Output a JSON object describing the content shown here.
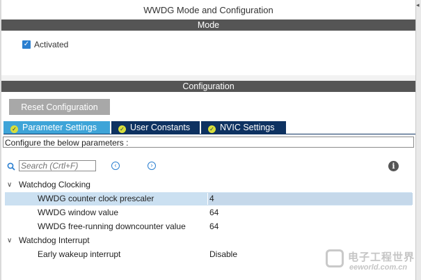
{
  "window": {
    "title": "WWDG Mode and Configuration"
  },
  "mode": {
    "header": "Mode",
    "activated": {
      "label": "Activated",
      "checked": true
    }
  },
  "configuration": {
    "header": "Configuration",
    "reset_button": "Reset Configuration",
    "tabs": [
      {
        "label": "Parameter Settings",
        "active": true
      },
      {
        "label": "User Constants",
        "active": false
      },
      {
        "label": "NVIC Settings",
        "active": false
      }
    ],
    "instructions": "Configure the below parameters :",
    "search": {
      "placeholder": "Search (Crtl+F)"
    },
    "groups": [
      {
        "label": "Watchdog Clocking",
        "params": [
          {
            "label": "WWDG counter clock prescaler",
            "value": "4",
            "selected": true
          },
          {
            "label": "WWDG window value",
            "value": "64",
            "selected": false
          },
          {
            "label": "WWDG free-running downcounter value",
            "value": "64",
            "selected": false
          }
        ]
      },
      {
        "label": "Watchdog Interrupt",
        "params": [
          {
            "label": "Early wakeup interrupt",
            "value": "Disable",
            "selected": false
          }
        ]
      }
    ]
  },
  "icons": {
    "search": "search-icon",
    "prev": "chevron-left-circle-icon",
    "next": "chevron-right-circle-icon",
    "info": "info-icon",
    "check": "check-circle-icon"
  },
  "watermark": {
    "line1": "电子工程世界",
    "line2": "eeworld.com.cn"
  },
  "colors": {
    "section_bar": "#555555",
    "tab_active": "#3ea4d8",
    "tab_inactive": "#0e3261",
    "selected_row": "#cbe0f1",
    "checkbox": "#2b7fd0"
  }
}
